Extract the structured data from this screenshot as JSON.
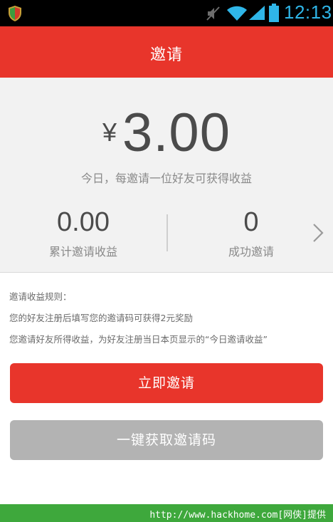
{
  "status_bar": {
    "time": "12:13"
  },
  "header": {
    "title": "邀请"
  },
  "summary": {
    "currency_symbol": "¥",
    "amount": "3.00",
    "caption": "今日，每邀请一位好友可获得收益",
    "stats": [
      {
        "value": "0.00",
        "label": "累计邀请收益"
      },
      {
        "value": "0",
        "label": "成功邀请"
      }
    ]
  },
  "rules": {
    "title": "邀请收益规则：",
    "lines": [
      "您的好友注册后填写您的邀请码可获得2元奖励",
      "您邀请好友所得收益，为好友注册当日本页显示的“今日邀请收益”"
    ]
  },
  "buttons": {
    "invite_label": "立即邀请",
    "get_code_label": "一键获取邀请码"
  },
  "watermark": {
    "text": "http://www.hackhome.com[网侠]提供"
  },
  "colors": {
    "accent": "#e8352b",
    "disabled_button": "#b3b3b3",
    "status_icons": "#2fb6e8",
    "watermark_bar": "#3ea83c"
  },
  "icons": [
    "shield-icon",
    "mute-icon",
    "wifi-icon",
    "signal-icon",
    "battery-icon",
    "chevron-right-icon"
  ]
}
